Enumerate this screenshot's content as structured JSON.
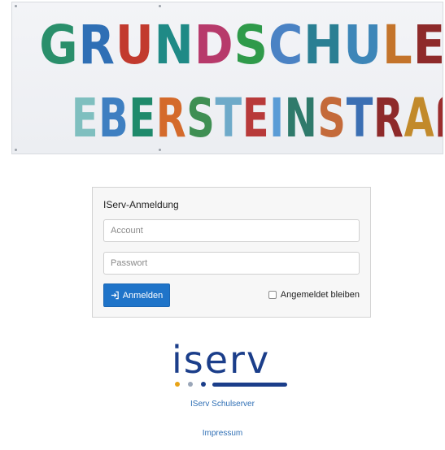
{
  "banner": {
    "line1": "GRUNDSCHULE",
    "line2": "EBERSTEINSTRAßE",
    "line1_colors": [
      "#2a8f6b",
      "#2f6fb5",
      "#c23a2e",
      "#1f8a86",
      "#b73a6b",
      "#2f9a4a",
      "#4a82c4",
      "#2a7f93",
      "#3d86b8",
      "#c4742b",
      "#8e2a2a"
    ],
    "line2_colors": [
      "#7fbfbf",
      "#3e7fc1",
      "#1f8a6b",
      "#d46a2b",
      "#3f8f53",
      "#6eaac9",
      "#b83a3a",
      "#5a9cd6",
      "#2f7a6b",
      "#c46a3a",
      "#3b6fb3",
      "#8e2a2a",
      "#c28a2b",
      "#9b2d2d",
      "#6bb3d1"
    ]
  },
  "login": {
    "title": "IServ-Anmeldung",
    "account_placeholder": "Account",
    "password_placeholder": "Passwort",
    "submit_label": "Anmelden",
    "submit_icon": "sign-in-icon",
    "remember_label": "Angemeldet bleiben"
  },
  "logo": {
    "text": "iserv",
    "dot_colors": [
      "#e8a317",
      "#9aa6b8",
      "#1b3e8a"
    ]
  },
  "links": {
    "server": "IServ Schulserver",
    "impressum": "Impressum"
  },
  "colors": {
    "primary_button": "#1f74c9",
    "link": "#2f6fb5",
    "logo_blue": "#1b3e8a"
  }
}
